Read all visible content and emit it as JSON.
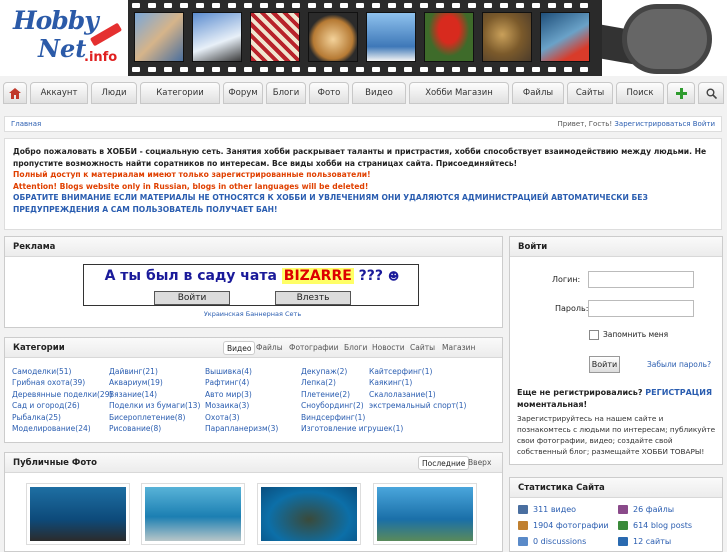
{
  "logo": {
    "hobby": "Hobby",
    "net": "Net",
    "info": ".info"
  },
  "nav": {
    "home_icon": "home-icon",
    "items": [
      "Аккаунт",
      "Люди",
      "Категории",
      "Форум",
      "Блоги",
      "Фото",
      "Видео",
      "Хобби Магазин",
      "Файлы",
      "Сайты",
      "Поиск"
    ],
    "add_icon": "add-icon",
    "search_icon": "search-icon"
  },
  "crumbs": {
    "home": "Главная",
    "greeting": "Привет, Гость!",
    "register": "Зарегистрироваться",
    "login": "Войти"
  },
  "welcome": {
    "line1": "Добро пожаловать в ХОББИ - социальную сеть. Занятия хобби раскрывает таланты и пристрастия, хобби способствует взаимодействию между людьми. Не пропустите возможность найти соратников по интересам. Все виды хобби на страницах сайта. Присоединяйтесь!",
    "line2": "Полный доступ к материалам имеют только зарегистрированные пользователи!",
    "line3": "Attention! Blogs website only in Russian, blogs in other languages will be deleted!",
    "line4": "ОБРАТИТЕ ВНИМАНИЕ ЕСЛИ МАТЕРИАЛЫ НЕ ОТНОСЯТСЯ К ХОББИ И УВЛЕЧЕНИЯМ ОНИ УДАЛЯЮТСЯ АДМИНИСТРАЦИЕЙ АВТОМАТИЧЕСКИ БЕЗ ПРЕДУПРЕЖДЕНИЯ А САМ ПОЛЬЗОВАТЕЛЬ ПОЛУЧАЕТ БАН!"
  },
  "ad": {
    "title": "Реклама",
    "text_before": "А ты был в саду чата",
    "text_brand": "BIZARRE",
    "text_after": "???",
    "btn_login": "Войти",
    "btn_enter": "Влезть",
    "caption": "Украинская Баннерная Сеть"
  },
  "categories": {
    "title": "Категории",
    "tabs": [
      "Видео",
      "Файлы",
      "Фотографии",
      "Блоги",
      "Новости",
      "Сайты",
      "Магазин"
    ],
    "col1": [
      "Самоделки(51)",
      "Грибная охота(39)",
      "Деревянные поделки(29)",
      "Сад и огород(26)",
      "Рыбалка(25)",
      "Моделирование(24)"
    ],
    "col2": [
      "Дайвинг(21)",
      "Аквариум(19)",
      "Вязание(14)",
      "Поделки из бумаги(13)",
      "Бисероплетение(8)",
      "Рисование(8)"
    ],
    "col3": [
      "Вышивка(4)",
      "Рафтинг(4)",
      "Авто мир(3)",
      "Мозаика(3)",
      "Охота(3)",
      "Парапланеризм(3)"
    ],
    "col4": [
      "Декупаж(2)",
      "Лепка(2)",
      "Плетение(2)",
      "Сноубординг(2)",
      "Виндсерфинг(1)",
      "Изготовление игрушек(1)"
    ],
    "col5": [
      "Кайтсерфинг(1)",
      "Каякинг(1)",
      "Скалолазание(1)",
      "экстремальный спорт(1)"
    ]
  },
  "photos": {
    "title": "Публичные Фото",
    "tab_latest": "Последние",
    "tab_top": "Вверх"
  },
  "login": {
    "title": "Войти",
    "login_label": "Логин:",
    "password_label": "Пароль:",
    "remember": "Запомнить меня",
    "button": "Войти",
    "forgot": "Забыли пароль?",
    "promo_q": "Еще не регистрировались?",
    "promo_link": "РЕГИСТРАЦИЯ",
    "promo_tail": "моментальная!",
    "promo_text": "Зарегистрируйтесь на нашем сайте и познакомтесь с людьми по интересам; публикуйте свои фотографии, видео; создайте свой собственный блог; размещайте ХОББИ ТОВАРЫ!"
  },
  "stats": {
    "title": "Статистика Сайта",
    "videos": "311 видео",
    "files": "26 файлы",
    "photos": "1904 фотографии",
    "posts": "614 blog posts",
    "discussions": "0 discussions",
    "sites": "12 сайты"
  },
  "colors": {
    "link": "#2a5db0",
    "warning": "#e04000",
    "brand_red": "#e02020"
  }
}
